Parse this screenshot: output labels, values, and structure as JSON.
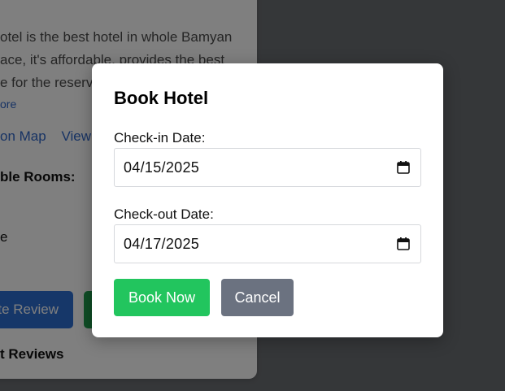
{
  "background": {
    "description_lines": [
      "otel is the best hotel in whole Bamyan",
      "ace, it's affordable, provides the best",
      "e for the reserv"
    ],
    "read_more": "ore",
    "links": [
      "on Map",
      "View"
    ],
    "rooms_label": "ble Rooms:",
    "room_fragment": "e",
    "review_button": "te Review",
    "reviews_heading": "t Reviews"
  },
  "modal": {
    "title": "Book Hotel",
    "checkin_label": "Check-in Date:",
    "checkin_value": "04/15/2025",
    "checkout_label": "Check-out Date:",
    "checkout_value": "04/17/2025",
    "book_button": "Book Now",
    "cancel_button": "Cancel"
  },
  "colors": {
    "book_button": "#22c55e",
    "cancel_button": "#6b7280",
    "link": "#2f66c9"
  }
}
